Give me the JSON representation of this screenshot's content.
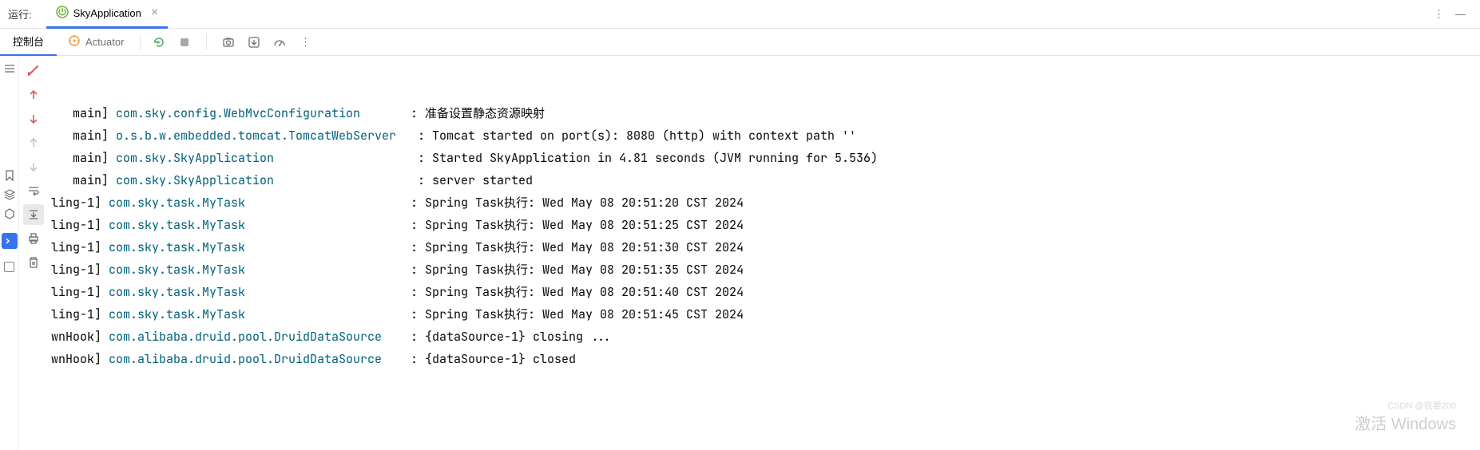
{
  "topBar": {
    "label": "运行:",
    "tabLabel": "SkyApplication",
    "closeGlyph": "×",
    "moreGlyph": "⋮",
    "minimizeGlyph": "—"
  },
  "toolbar": {
    "consoleLabel": "控制台",
    "actuatorLabel": "Actuator",
    "moreGlyph": "⋮"
  },
  "logs": [
    {
      "thread": "   main] ",
      "class": "com.sky.config.WebMvcConfiguration      ",
      "sep": " : ",
      "msg": "准备设置静态资源映射"
    },
    {
      "thread": "   main] ",
      "class": "o.s.b.w.embedded.tomcat.TomcatWebServer  ",
      "sep": " : ",
      "msg": "Tomcat started on port(s): 8080 (http) with context path ''"
    },
    {
      "thread": "   main] ",
      "class": "com.sky.SkyApplication                   ",
      "sep": " : ",
      "msg": "Started SkyApplication in 4.81 seconds (JVM running for 5.536)"
    },
    {
      "thread": "   main] ",
      "class": "com.sky.SkyApplication                   ",
      "sep": " : ",
      "msg": "server started"
    },
    {
      "thread": "ling-1] ",
      "class": "com.sky.task.MyTask                      ",
      "sep": " : ",
      "msg": "Spring Task执行: Wed May 08 20:51:20 CST 2024"
    },
    {
      "thread": "ling-1] ",
      "class": "com.sky.task.MyTask                      ",
      "sep": " : ",
      "msg": "Spring Task执行: Wed May 08 20:51:25 CST 2024"
    },
    {
      "thread": "ling-1] ",
      "class": "com.sky.task.MyTask                      ",
      "sep": " : ",
      "msg": "Spring Task执行: Wed May 08 20:51:30 CST 2024"
    },
    {
      "thread": "ling-1] ",
      "class": "com.sky.task.MyTask                      ",
      "sep": " : ",
      "msg": "Spring Task执行: Wed May 08 20:51:35 CST 2024"
    },
    {
      "thread": "ling-1] ",
      "class": "com.sky.task.MyTask                      ",
      "sep": " : ",
      "msg": "Spring Task执行: Wed May 08 20:51:40 CST 2024"
    },
    {
      "thread": "ling-1] ",
      "class": "com.sky.task.MyTask                      ",
      "sep": " : ",
      "msg": "Spring Task执行: Wed May 08 20:51:45 CST 2024"
    },
    {
      "thread": "wnHook] ",
      "class": "com.alibaba.druid.pool.DruidDataSource   ",
      "sep": " : ",
      "msg": "{dataSource-1} closing ..."
    },
    {
      "thread": "wnHook] ",
      "class": "com.alibaba.druid.pool.DruidDataSource   ",
      "sep": " : ",
      "msg": "{dataSource-1} closed"
    }
  ],
  "watermark": {
    "main": "激活 Windows",
    "small": "CSDN @我要200"
  }
}
